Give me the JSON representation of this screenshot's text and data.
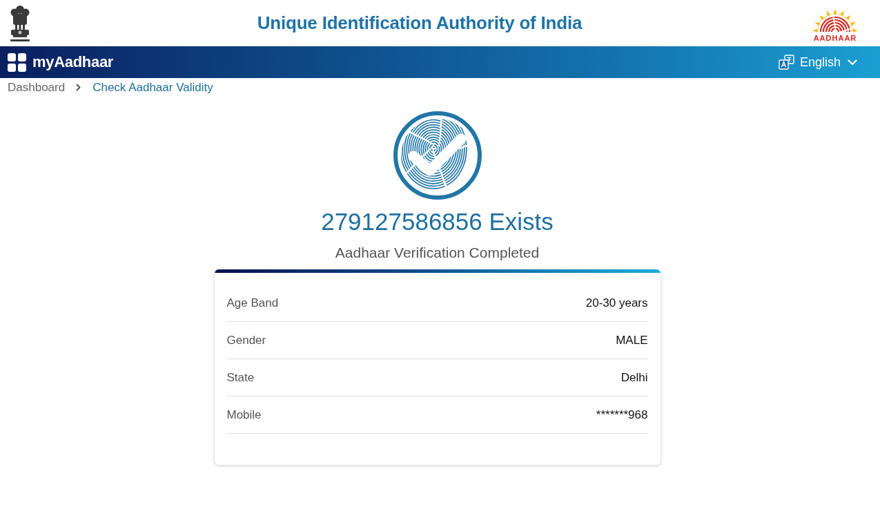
{
  "header": {
    "title": "Unique Identification Authority of India",
    "logo_text": "AADHAAR"
  },
  "navbar": {
    "app_name": "myAadhaar",
    "language": "English"
  },
  "breadcrumb": [
    {
      "label": "Dashboard",
      "current": false
    },
    {
      "label": "Check Aadhaar Validity",
      "current": true
    }
  ],
  "result": {
    "heading": "279127586856 Exists",
    "subtitle": "Aadhaar Verification Completed"
  },
  "details": [
    {
      "label": "Age Band",
      "value": "20-30 years"
    },
    {
      "label": "Gender",
      "value": "MALE"
    },
    {
      "label": "State",
      "value": "Delhi"
    },
    {
      "label": "Mobile",
      "value": "*******968"
    }
  ]
}
